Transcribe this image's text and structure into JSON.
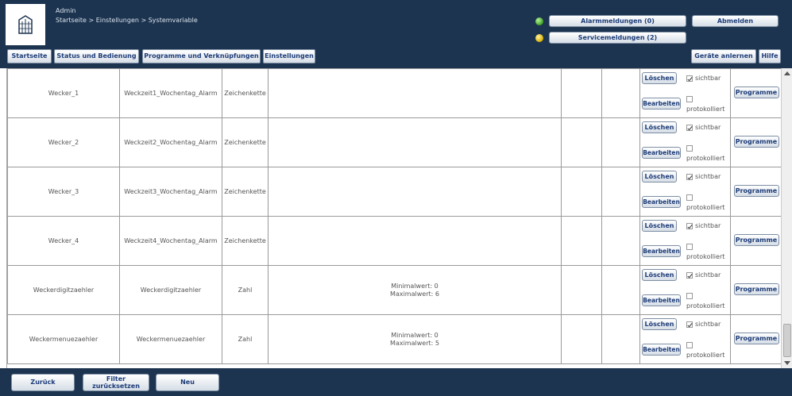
{
  "header": {
    "user": "Admin",
    "breadcrumb": "Startseite > Einstellungen > Systemvariable",
    "alarm_button": "Alarmmeldungen (0)",
    "service_button": "Servicemeldungen (2)",
    "logout_button": "Abmelden",
    "led_alarm_color": "#3ca21e",
    "led_service_color": "#d8b000"
  },
  "tabs": {
    "start": "Startseite",
    "status": "Status und Bedienung",
    "programs": "Programme und Verknüpfungen",
    "settings": "Einstellungen",
    "pair": "Geräte anlernen",
    "help": "Hilfe"
  },
  "actions": {
    "delete": "Löschen",
    "edit": "Bearbeiten",
    "visible": "sichtbar",
    "logged": "protokolliert",
    "programs": "Programme"
  },
  "rows": [
    {
      "name": "Wecker_1",
      "description": "Weckzeit1_Wochentag_Alarm",
      "type": "Zeichenkette",
      "values_line1": "",
      "values_line2": "",
      "visible": true,
      "logged": false
    },
    {
      "name": "Wecker_2",
      "description": "Weckzeit2_Wochentag_Alarm",
      "type": "Zeichenkette",
      "values_line1": "",
      "values_line2": "",
      "visible": true,
      "logged": false
    },
    {
      "name": "Wecker_3",
      "description": "Weckzeit3_Wochentag_Alarm",
      "type": "Zeichenkette",
      "values_line1": "",
      "values_line2": "",
      "visible": true,
      "logged": false
    },
    {
      "name": "Wecker_4",
      "description": "Weckzeit4_Wochentag_Alarm",
      "type": "Zeichenkette",
      "values_line1": "",
      "values_line2": "",
      "visible": true,
      "logged": false
    },
    {
      "name": "Weckerdigitzaehler",
      "description": "Weckerdigitzaehler",
      "type": "Zahl",
      "values_line1": "Minimalwert: 0",
      "values_line2": "Maximalwert: 6",
      "visible": true,
      "logged": false
    },
    {
      "name": "Weckermenuezaehler",
      "description": "Weckermenuezaehler",
      "type": "Zahl",
      "values_line1": "Minimalwert: 0",
      "values_line2": "Maximalwert: 5",
      "visible": true,
      "logged": false
    }
  ],
  "footer": {
    "back": "Zurück",
    "filter_line1": "Filter",
    "filter_line2": "zurücksetzen",
    "new": "Neu"
  }
}
